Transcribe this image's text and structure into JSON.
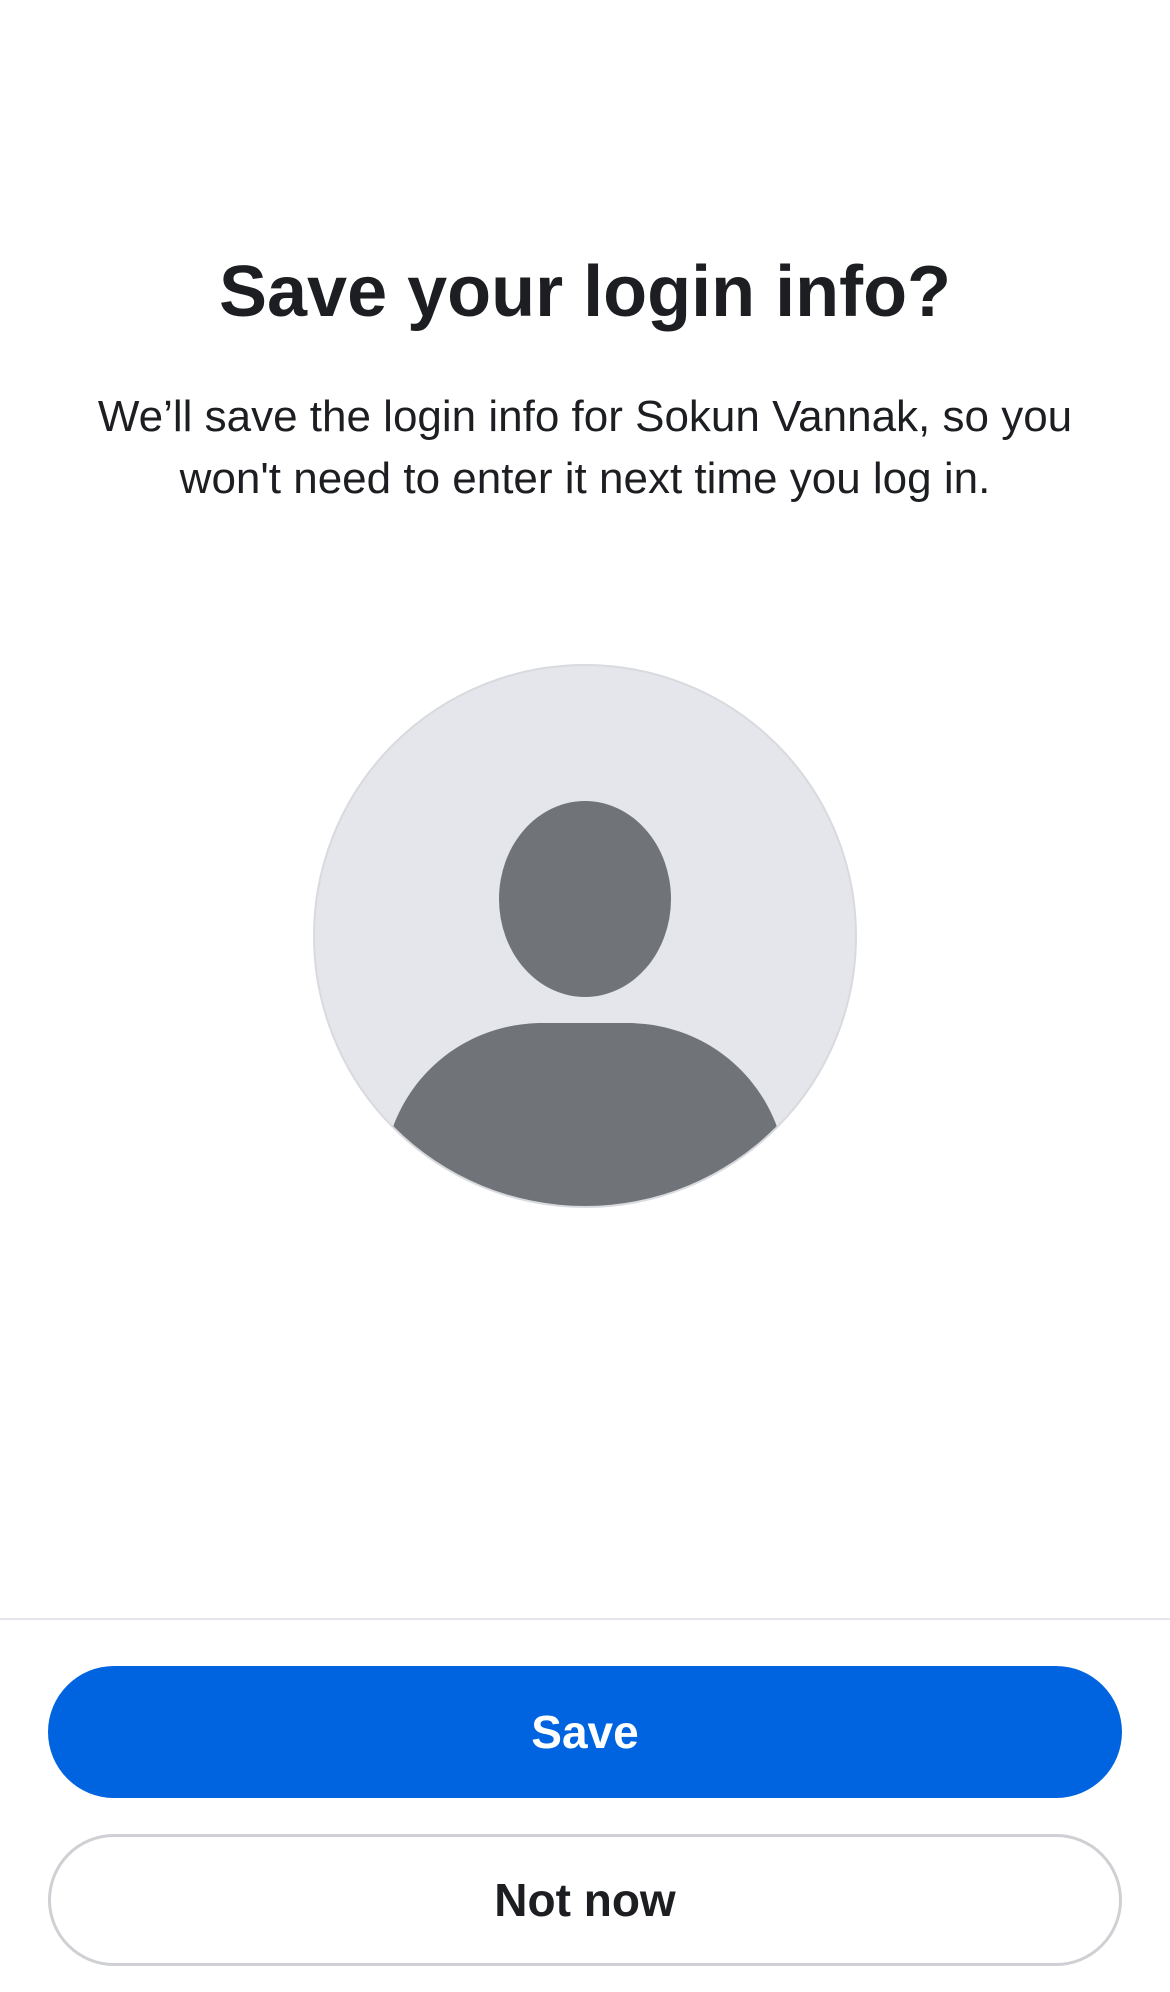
{
  "dialog": {
    "title": "Save your login info?",
    "description": "We’ll save the login info for Sokun Vannak, so you won't need to enter it next time you log in."
  },
  "avatar": {
    "icon": "default-profile-silhouette-icon",
    "background_color": "#e4e6eb",
    "silhouette_color": "#707378"
  },
  "actions": {
    "save_label": "Save",
    "not_now_label": "Not now"
  },
  "colors": {
    "primary": "#0064e0",
    "text": "#1c1e21",
    "border": "#ced0d4"
  }
}
